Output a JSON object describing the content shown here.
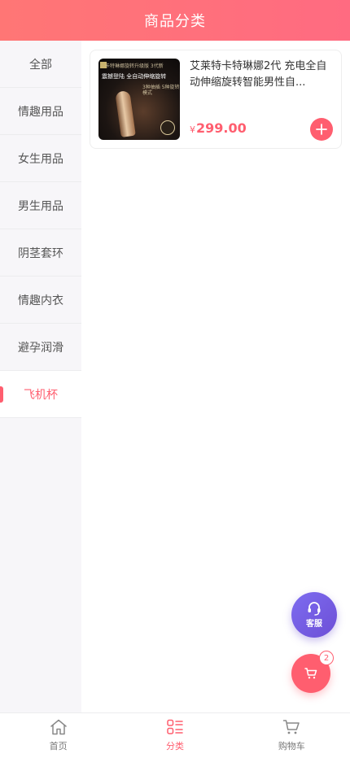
{
  "header": {
    "title": "商品分类"
  },
  "sidebar": {
    "items": [
      {
        "label": "全部",
        "active": false
      },
      {
        "label": "情趣用品",
        "active": false
      },
      {
        "label": "女生用品",
        "active": false
      },
      {
        "label": "男生用品",
        "active": false
      },
      {
        "label": "阴茎套环",
        "active": false
      },
      {
        "label": "情趣内衣",
        "active": false
      },
      {
        "label": "避孕润滑",
        "active": false
      },
      {
        "label": "飞机杯",
        "active": true
      }
    ]
  },
  "products": [
    {
      "name": "艾莱特卡特琳娜2代 充电全自动伸缩旋转智能男性自...",
      "currency": "¥",
      "price": "299.00",
      "image_texts": {
        "top_line": "卡特琳娜旋转升级版 3代新",
        "headline": "震撼登陆 全自动伸缩旋转",
        "modes": "3种抽插 5种旋转模式"
      }
    }
  ],
  "floating": {
    "service_label": "客服",
    "cart_count": "2"
  },
  "tabbar": {
    "tabs": [
      {
        "label": "首页",
        "icon": "home-icon",
        "active": false
      },
      {
        "label": "分类",
        "icon": "category-icon",
        "active": true
      },
      {
        "label": "购物车",
        "icon": "cart-icon",
        "active": false
      }
    ]
  },
  "colors": {
    "accent": "#ff5e6f",
    "header_gradient_start": "#ff7675",
    "header_gradient_end": "#ff6b81",
    "service_button": "#7d6cf0"
  }
}
